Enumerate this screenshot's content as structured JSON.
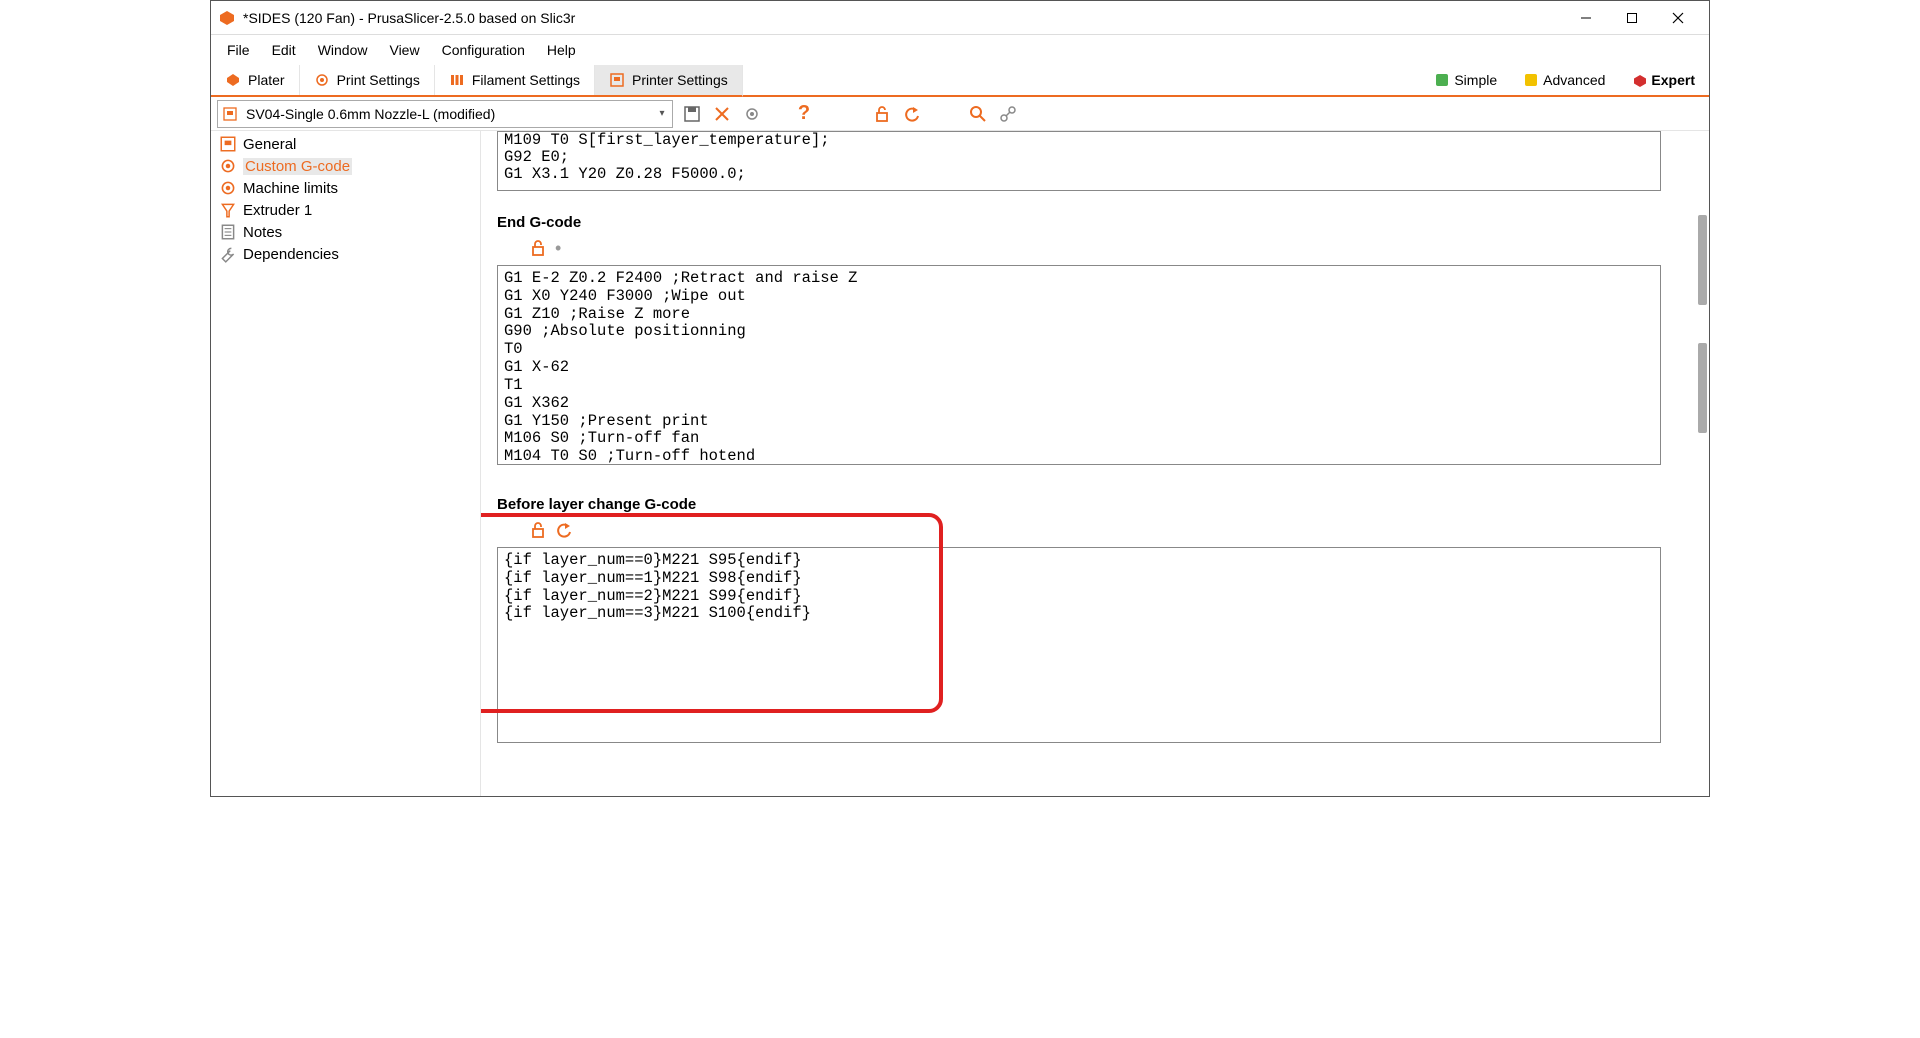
{
  "window": {
    "title": "*SIDES (120 Fan) - PrusaSlicer-2.5.0 based on Slic3r"
  },
  "menu": {
    "items": [
      "File",
      "Edit",
      "Window",
      "View",
      "Configuration",
      "Help"
    ]
  },
  "tabs": {
    "plater": "Plater",
    "print_settings": "Print Settings",
    "filament_settings": "Filament Settings",
    "printer_settings": "Printer Settings"
  },
  "modes": {
    "simple": "Simple",
    "advanced": "Advanced",
    "expert": "Expert"
  },
  "preset": {
    "selected": "SV04-Single 0.6mm Nozzle-L (modified)"
  },
  "sidebar": {
    "items": [
      {
        "label": "General"
      },
      {
        "label": "Custom G-code"
      },
      {
        "label": "Machine limits"
      },
      {
        "label": "Extruder 1"
      },
      {
        "label": "Notes"
      },
      {
        "label": "Dependencies"
      }
    ]
  },
  "sections": {
    "start_gcode_tail": "M109 T0 S[first_layer_temperature];\nG92 E0;\nG1 X3.1 Y20 Z0.28 F5000.0;",
    "end_title": "End G-code",
    "end_gcode": "G1 E-2 Z0.2 F2400 ;Retract and raise Z\nG1 X0 Y240 F3000 ;Wipe out\nG1 Z10 ;Raise Z more\nG90 ;Absolute positionning\nT0\nG1 X-62\nT1\nG1 X362\nG1 Y150 ;Present print\nM106 S0 ;Turn-off fan\nM104 T0 S0 ;Turn-off hotend",
    "before_title": "Before layer change G-code",
    "before_gcode": "{if layer_num==0}M221 S95{endif}\n{if layer_num==1}M221 S98{endif}\n{if layer_num==2}M221 S99{endif}\n{if layer_num==3}M221 S100{endif}"
  }
}
